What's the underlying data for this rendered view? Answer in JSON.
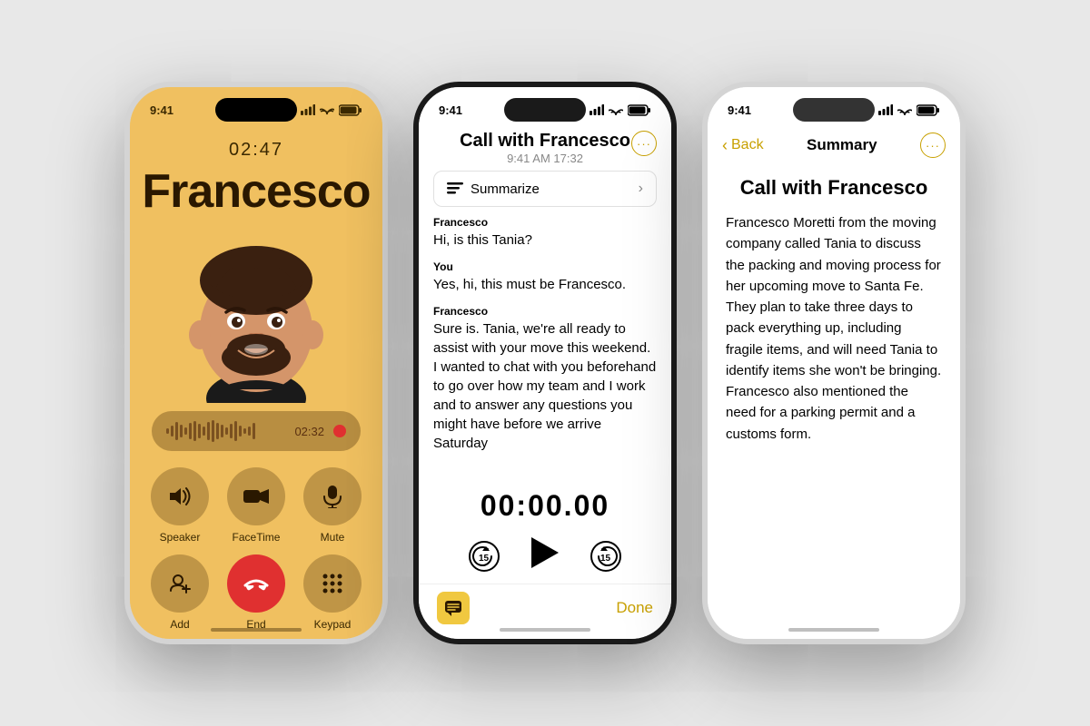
{
  "background": "#e8e8e8",
  "phone1": {
    "status_time": "9:41",
    "call_timer": "02:47",
    "caller_name": "Francesco",
    "rec_time": "02:32",
    "controls": [
      {
        "label": "Speaker",
        "icon": "🔊"
      },
      {
        "label": "FaceTime",
        "icon": "📹"
      },
      {
        "label": "Mute",
        "icon": "🎙"
      }
    ],
    "controls2": [
      {
        "label": "Add",
        "icon": "👤"
      },
      {
        "label": "End",
        "icon": "📞",
        "type": "end"
      },
      {
        "label": "Keypad",
        "icon": "⌨"
      }
    ]
  },
  "phone2": {
    "status_time": "9:41",
    "title": "Call with Francesco",
    "subtitle": "9:41 AM  17:32",
    "summarize_label": "Summarize",
    "transcripts": [
      {
        "speaker": "Francesco",
        "text": "Hi, is this Tania?"
      },
      {
        "speaker": "You",
        "text": "Yes, hi, this must be Francesco."
      },
      {
        "speaker": "Francesco",
        "text": "Sure is. Tania, we're all ready to assist with your move this weekend. I wanted to chat with you beforehand to go over how my team and I work and to answer any questions you might have before we arrive Saturday"
      }
    ],
    "playback_time": "00:00.00",
    "done_label": "Done"
  },
  "phone3": {
    "status_time": "9:41",
    "back_label": "Back",
    "nav_title": "Summary",
    "call_title": "Call with Francesco",
    "summary_text": "Francesco Moretti from the moving company called Tania to discuss the packing and moving process for her upcoming move to Santa Fe. They plan to take three days to pack everything up, including fragile items, and will need Tania to identify items she won't be bringing. Francesco also mentioned the need for a parking permit and a customs form."
  }
}
